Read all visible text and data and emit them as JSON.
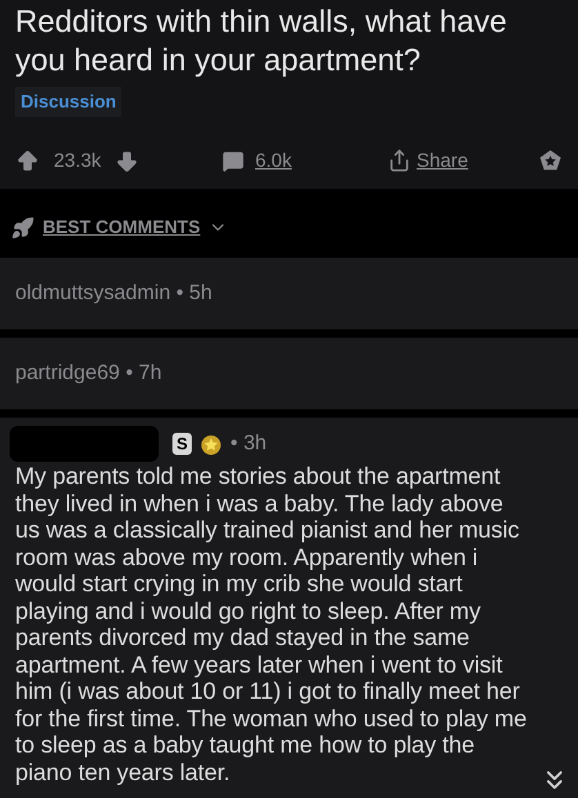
{
  "post": {
    "title": "Redditors with thin walls, what have you heard in your apartment?",
    "flair": "Discussion",
    "score": "23.3k",
    "comments": "6.0k",
    "share": "Share"
  },
  "sort": {
    "label": "BEST COMMENTS"
  },
  "separator": "•",
  "comments": [
    {
      "kind": "collapsed",
      "author": "oldmuttsysadmin",
      "time": "5h"
    },
    {
      "kind": "collapsed",
      "author": "partridge69",
      "time": "7h"
    },
    {
      "kind": "expanded",
      "time": "3h",
      "badge": "S",
      "body": "My parents told me stories about the apartment they lived in when i was a baby. The lady above us was a classically trained pianist and her music room was above my room. Apparently when i would start crying in my crib she would start playing and i would go right to sleep. After my parents divorced my dad stayed in the same apartment. A few years later when i went to visit him (i was about 10 or 11) i got to finally meet her for the first time. The woman who used to play me to sleep as a baby taught me how to play the piano ten years later."
    }
  ]
}
